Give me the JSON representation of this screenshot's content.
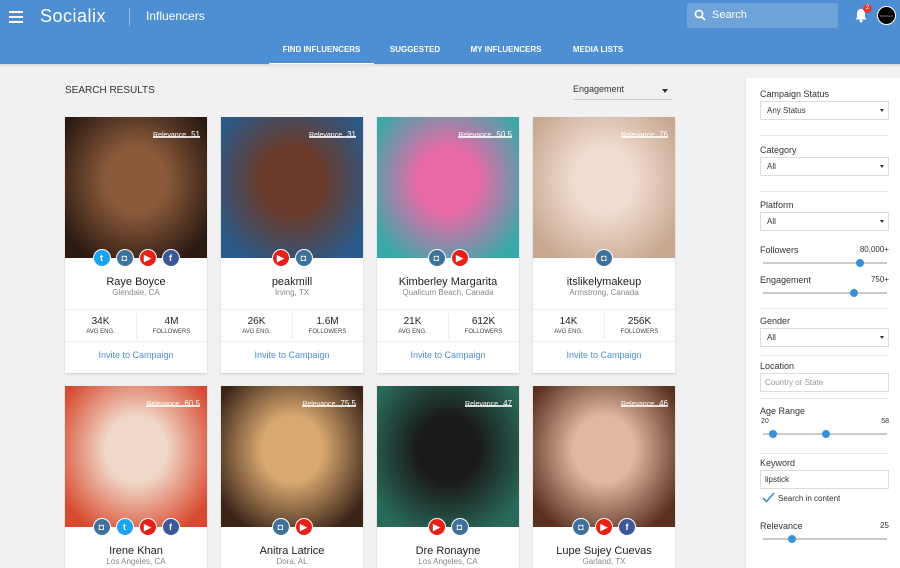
{
  "app": {
    "name": "Socialix",
    "page_title": "Influencers"
  },
  "search": {
    "placeholder": "Search",
    "icon": "search-icon"
  },
  "notifications": {
    "count": "2"
  },
  "user": {
    "avatar_text": "SOCIALIX"
  },
  "tabs": [
    {
      "label": "FIND INFLUENCERS",
      "active": true
    },
    {
      "label": "SUGGESTED"
    },
    {
      "label": "MY INFLUENCERS"
    },
    {
      "label": "MEDIA LISTS"
    }
  ],
  "results": {
    "title": "SEARCH RESULTS",
    "sort": "Engagement"
  },
  "cards": [
    {
      "name": "Raye Boyce",
      "location": "Glendale, CA",
      "relevance_label": "Relevance",
      "relevance": "51",
      "networks": [
        "twitter",
        "instagram",
        "youtube",
        "facebook"
      ],
      "avg_eng": "34K",
      "avg_eng_label": "AVG ENG.",
      "followers": "4M",
      "followers_label": "FOLLOWERS",
      "invite": "Invite to Campaign",
      "colors": [
        "#2b1a12",
        "#8a5a3a"
      ]
    },
    {
      "name": "peakmill",
      "location": "Irving, TX",
      "relevance_label": "Relevance",
      "relevance": "31",
      "networks": [
        "youtube",
        "instagram"
      ],
      "avg_eng": "26K",
      "avg_eng_label": "AVG ENG.",
      "followers": "1.6M",
      "followers_label": "FOLLOWERS",
      "invite": "Invite to Campaign",
      "colors": [
        "#2a5a8a",
        "#6a3a2a"
      ]
    },
    {
      "name": "Kimberley Margarita",
      "location": "Qualicum Beach, Canada",
      "relevance_label": "Relevance",
      "relevance": "50.5",
      "networks": [
        "instagram",
        "youtube"
      ],
      "avg_eng": "21K",
      "avg_eng_label": "AVG ENG.",
      "followers": "612K",
      "followers_label": "FOLLOWERS",
      "invite": "Invite to Campaign",
      "colors": [
        "#3aa8a8",
        "#e86aa8"
      ]
    },
    {
      "name": "itslikelymakeup",
      "location": "Armstrong, Canada",
      "relevance_label": "Relevance",
      "relevance": "76",
      "networks": [
        "instagram"
      ],
      "avg_eng": "14K",
      "avg_eng_label": "AVG ENG.",
      "followers": "256K",
      "followers_label": "FOLLOWERS",
      "invite": "Invite to Campaign",
      "colors": [
        "#c8a890",
        "#f0dcd0"
      ]
    },
    {
      "name": "Irene Khan",
      "location": "Los Angeles, CA",
      "relevance_label": "Relevance",
      "relevance": "60.5",
      "networks": [
        "instagram",
        "twitter",
        "youtube",
        "facebook"
      ],
      "colors": [
        "#d84a30",
        "#f0d8c8"
      ]
    },
    {
      "name": "Anitra Latrice",
      "location": "Dora, AL",
      "relevance_label": "Relevance",
      "relevance": "75.5",
      "networks": [
        "instagram",
        "youtube"
      ],
      "colors": [
        "#3a2418",
        "#d8a870"
      ]
    },
    {
      "name": "Dre Ronayne",
      "location": "Los Angeles, CA",
      "relevance_label": "Relevance",
      "relevance": "47",
      "networks": [
        "youtube",
        "instagram"
      ],
      "colors": [
        "#2a6a5a",
        "#1a1a1a"
      ]
    },
    {
      "name": "Lupe Sujey Cuevas",
      "location": "Garland, TX",
      "relevance_label": "Relevance",
      "relevance": "46",
      "networks": [
        "instagram",
        "youtube",
        "facebook"
      ],
      "colors": [
        "#5a3020",
        "#e0b8a0"
      ]
    }
  ],
  "filters": {
    "campaign_status": {
      "label": "Campaign Status",
      "value": "Any Status"
    },
    "category": {
      "label": "Category",
      "value": "All"
    },
    "platform": {
      "label": "Platform",
      "value": "All"
    },
    "followers": {
      "label": "Followers",
      "value": "80,000+",
      "level": 0.78
    },
    "engagement": {
      "label": "Engagement",
      "value": "750+",
      "level": 0.73
    },
    "gender": {
      "label": "Gender",
      "value": "All"
    },
    "location": {
      "label": "Location",
      "placeholder": "Country or State"
    },
    "age_range": {
      "label": "Age Range",
      "min": "20",
      "max": "58",
      "low": 0.08,
      "high": 0.51
    },
    "keyword": {
      "label": "Keyword",
      "value": "lipstick",
      "checkbox": "Search in content",
      "checked": true
    },
    "relevance": {
      "label": "Relevance",
      "value": "25",
      "level": 0.23
    }
  }
}
